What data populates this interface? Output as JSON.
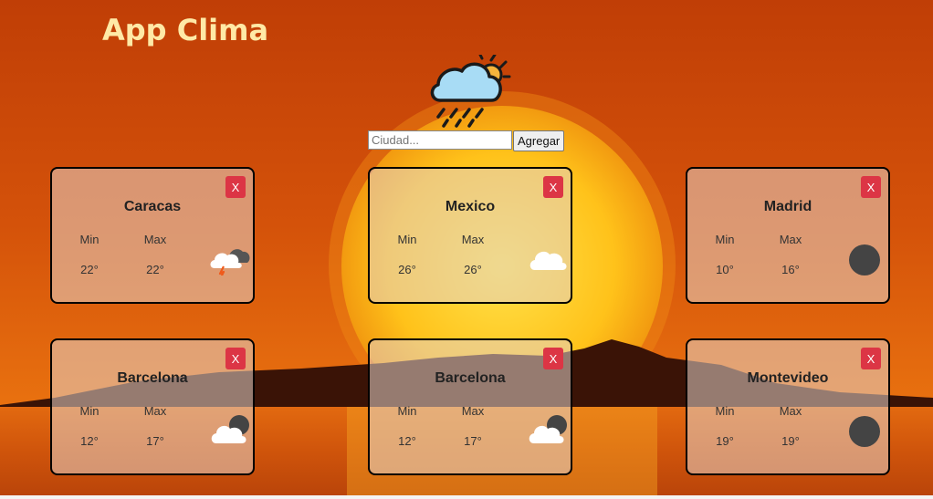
{
  "app": {
    "title": "App Clima"
  },
  "search": {
    "placeholder": "Ciudad...",
    "value": "",
    "button_label": "Agregar"
  },
  "cards": [
    {
      "city": "Caracas",
      "min_label": "Min",
      "max_label": "Max",
      "min": "22°",
      "max": "22°",
      "icon": "thunderstorm-icon",
      "close_label": "X"
    },
    {
      "city": "Mexico",
      "min_label": "Min",
      "max_label": "Max",
      "min": "26°",
      "max": "26°",
      "icon": "cloud-icon",
      "close_label": "X"
    },
    {
      "city": "Madrid",
      "min_label": "Min",
      "max_label": "Max",
      "min": "10°",
      "max": "16°",
      "icon": "clear-night-icon",
      "close_label": "X"
    },
    {
      "city": "Barcelona",
      "min_label": "Min",
      "max_label": "Max",
      "min": "12°",
      "max": "17°",
      "icon": "partly-cloudy-night-icon",
      "close_label": "X"
    },
    {
      "city": "Barcelona",
      "min_label": "Min",
      "max_label": "Max",
      "min": "12°",
      "max": "17°",
      "icon": "partly-cloudy-night-icon",
      "close_label": "X"
    },
    {
      "city": "Montevideo",
      "min_label": "Min",
      "max_label": "Max",
      "min": "19°",
      "max": "19°",
      "icon": "clear-night-icon",
      "close_label": "X"
    }
  ],
  "colors": {
    "close_button": "#dc3545",
    "title": "#ffe9a6",
    "sky": "#c74406",
    "sun": "#ffd21a"
  }
}
